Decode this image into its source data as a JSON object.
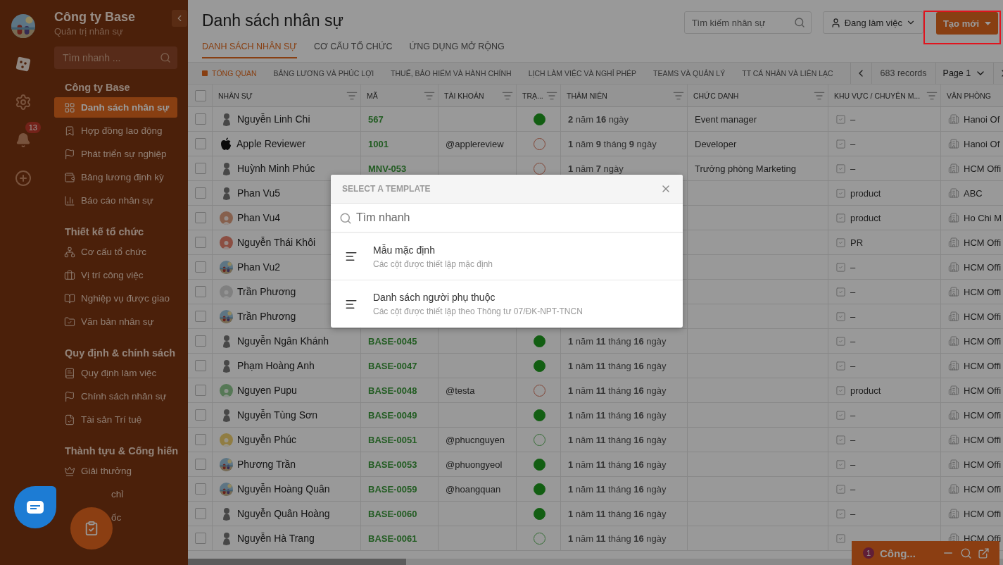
{
  "rail": {
    "badge": "13"
  },
  "nav": {
    "company": "Công ty Base",
    "subtitle": "Quản trị nhân sự",
    "search_placeholder": "Tìm nhanh ...",
    "sections": [
      {
        "title": "Công ty Base",
        "items": [
          {
            "label": "Danh sách nhân sự",
            "selected": true
          },
          {
            "label": "Hợp đồng lao động",
            "selected": false
          },
          {
            "label": "Phát triển sự nghiệp",
            "selected": false
          },
          {
            "label": "Bảng lương định kỳ",
            "selected": false
          },
          {
            "label": "Báo cáo nhân sự",
            "selected": false
          }
        ]
      },
      {
        "title": "Thiết kế tổ chức",
        "items": [
          {
            "label": "Cơ cấu tổ chức",
            "selected": false
          },
          {
            "label": "Vị trí công việc",
            "selected": false
          },
          {
            "label": "Nghiệp vụ được giao",
            "selected": false
          },
          {
            "label": "Văn bản nhân sự",
            "selected": false
          }
        ]
      },
      {
        "title": "Quy định & chính sách",
        "items": [
          {
            "label": "Quy định làm việc",
            "selected": false
          },
          {
            "label": "Chính sách nhân sự",
            "selected": false
          },
          {
            "label": "Tài sản Trí tuệ",
            "selected": false
          }
        ]
      },
      {
        "title": "Thành tựu & Cống hiến",
        "items": [
          {
            "label": "Giải thưởng",
            "selected": false,
            "covered": false
          },
          {
            "label": "chỉ",
            "selected": false,
            "covered": true
          },
          {
            "label": "ốc",
            "selected": false,
            "covered": true
          }
        ]
      }
    ]
  },
  "header": {
    "title": "Danh sách nhân sự",
    "search_placeholder": "Tìm kiếm nhân sự",
    "filter": "Đang làm việc",
    "create": "Tạo mới",
    "create_highlighted": true,
    "tabs": [
      {
        "label": "DANH SÁCH NHÂN SỰ",
        "selected": true
      },
      {
        "label": "CƠ CẤU TỔ CHỨC",
        "selected": false
      },
      {
        "label": "ỨNG DỤNG MỞ RỘNG",
        "selected": false
      }
    ]
  },
  "subtabs": [
    {
      "label": "TỔNG QUAN",
      "selected": true
    },
    {
      "label": "BẢNG LƯƠNG VÀ PHÚC LỢI",
      "selected": false
    },
    {
      "label": "THUẾ, BẢO HIỂM VÀ HÀNH CHÍNH",
      "selected": false
    },
    {
      "label": "LỊCH LÀM VIỆC VÀ NGHỈ PHÉP",
      "selected": false
    },
    {
      "label": "TEAMS VÀ QUẢN LÝ",
      "selected": false
    },
    {
      "label": "TT CÁ NHÂN VÀ LIÊN LẠC",
      "selected": false
    }
  ],
  "pagination": {
    "records": "683 records",
    "page": "Page 1"
  },
  "table": {
    "all_checked": false,
    "columns": [
      {
        "label": "NHÂN SỰ",
        "filterable": true
      },
      {
        "label": "MÃ",
        "filterable": true
      },
      {
        "label": "TÀI KHOẢN",
        "filterable": true
      },
      {
        "label": "TRẠ...",
        "filterable": true
      },
      {
        "label": "THÂM NIÊN",
        "filterable": true
      },
      {
        "label": "CHỨC DANH",
        "filterable": true
      },
      {
        "label": "KHU VỰC / CHUYÊN M...",
        "filterable": true
      },
      {
        "label": "VĂN PHÒNG",
        "filterable": false
      }
    ],
    "rows": [
      {
        "checked": false,
        "avatar": {
          "kind": "silhouette"
        },
        "name": "Nguyễn Linh Chi",
        "code": "567",
        "status": {
          "kind": "active"
        },
        "tenure": "**2** năm **16** ngày",
        "title": "Event manager",
        "area": "–",
        "office": "Hanoi Of"
      },
      {
        "checked": false,
        "avatar": {
          "kind": "logo"
        },
        "name": "Apple Reviewer",
        "code": "1001",
        "account": "@applereview",
        "status": {
          "kind": "inactive"
        },
        "tenure": "**1** năm **9** tháng **9** ngày",
        "title": "Developer",
        "area": "–",
        "office": "Hanoi Of"
      },
      {
        "checked": false,
        "avatar": {
          "kind": "silhouette"
        },
        "name": "Huỳnh Minh Phúc",
        "code": "MNV-053",
        "status": {
          "kind": "inactive"
        },
        "tenure": "**1** năm **7** ngày",
        "title": "Trưởng phòng Marketing",
        "area": "–",
        "office": "HCM Offi"
      },
      {
        "checked": false,
        "avatar": {
          "kind": "silhouette"
        },
        "name": "Phan Vu5",
        "area": "product",
        "office": "ABC"
      },
      {
        "checked": false,
        "avatar": {
          "kind": "default"
        },
        "name": "Phan Vu4",
        "area": "product",
        "office": "Ho Chi M"
      },
      {
        "checked": false,
        "avatar": {
          "kind": "default"
        },
        "name": "Nguyễn Thái Khôi",
        "area": "PR",
        "office": "HCM Offi"
      },
      {
        "checked": false,
        "name": "Phan Vu2",
        "area": "–",
        "office": "HCM Offi"
      },
      {
        "checked": false,
        "avatar": {
          "kind": "default"
        },
        "name": "Trần Phương",
        "area": "–",
        "office": "HCM Offi"
      },
      {
        "checked": false,
        "name": "Trần Phương",
        "area": "–",
        "office": "HCM Offi"
      },
      {
        "checked": false,
        "avatar": {
          "kind": "silhouette"
        },
        "name": "Nguyễn Ngân Khánh",
        "code": "BASE-0045",
        "status": {
          "kind": "active"
        },
        "tenure": "**1** năm **11** tháng **16** ngày",
        "area": "–",
        "office": "HCM Offi"
      },
      {
        "checked": false,
        "avatar": {
          "kind": "silhouette"
        },
        "name": "Phạm Hoàng Anh",
        "code": "BASE-0047",
        "status": {
          "kind": "active"
        },
        "tenure": "**1** năm **11** tháng **16** ngày",
        "area": "–",
        "office": "HCM Offi"
      },
      {
        "checked": false,
        "avatar": {
          "kind": "default"
        },
        "name": "Nguyen Pupu",
        "code": "BASE-0048",
        "account": "@testa",
        "status": {
          "kind": "inactive"
        },
        "tenure": "**1** năm **11** tháng **16** ngày",
        "area": "product",
        "office": "HCM Offi"
      },
      {
        "checked": false,
        "avatar": {
          "kind": "silhouette"
        },
        "name": "Nguyễn Tùng Sơn",
        "code": "BASE-0049",
        "status": {
          "kind": "active"
        },
        "tenure": "**1** năm **11** tháng **16** ngày",
        "area": "–",
        "office": "HCM Offi"
      },
      {
        "checked": false,
        "avatar": {
          "kind": "default"
        },
        "name": "Nguyễn Phúc",
        "code": "BASE-0051",
        "account": "@phucnguyen",
        "status": {
          "kind": "pending"
        },
        "tenure": "**1** năm **11** tháng **16** ngày",
        "area": "–",
        "office": "HCM Offi"
      },
      {
        "checked": false,
        "name": "Phương Trần",
        "code": "BASE-0053",
        "account": "@phuongyeol",
        "status": {
          "kind": "active"
        },
        "tenure": "**1** năm **11** tháng **16** ngày",
        "area": "–",
        "office": "HCM Offi"
      },
      {
        "checked": false,
        "name": "Nguyễn Hoàng Quân",
        "code": "BASE-0059",
        "account": "@hoangquan",
        "status": {
          "kind": "active"
        },
        "tenure": "**1** năm **11** tháng **16** ngày",
        "area": "–",
        "office": "HCM Offi"
      },
      {
        "checked": false,
        "avatar": {
          "kind": "silhouette"
        },
        "name": "Nguyễn Quân Hoàng",
        "code": "BASE-0060",
        "status": {
          "kind": "active"
        },
        "tenure": "**1** năm **11** tháng **16** ngày",
        "area": "–",
        "office": "HCM Offi"
      },
      {
        "checked": false,
        "avatar": {
          "kind": "silhouette"
        },
        "name": "Nguyễn Hà Trang",
        "code": "BASE-0061",
        "status": {
          "kind": "pending"
        },
        "tenure": "**1** năm **11** tháng **16** ngày",
        "office": "HCM Offi"
      }
    ]
  },
  "chat_bar": {
    "badge": "1",
    "title": "Công..."
  },
  "modal": {
    "title": "SELECT A TEMPLATE",
    "search_placeholder": "Tìm nhanh",
    "templates": [
      {
        "name": "Mẫu mặc định",
        "description": "Các cột được thiết lập mặc định"
      },
      {
        "name": "Danh sách người phụ thuộc",
        "description": "Các cột được thiết lập theo Thông tư 07/ĐK-NPT-TNCN"
      }
    ]
  }
}
